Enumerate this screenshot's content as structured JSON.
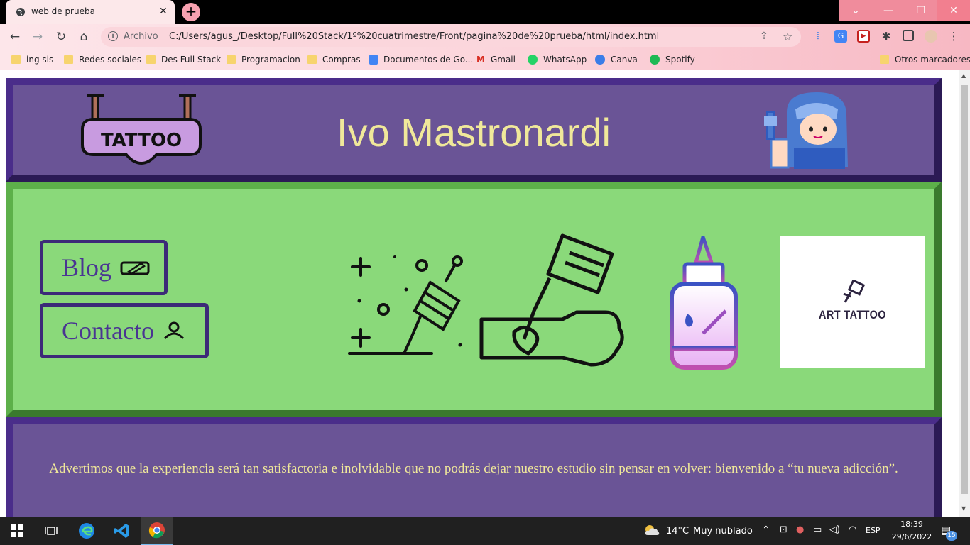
{
  "browser": {
    "tab_title": "web de prueba",
    "tab_close": "✕",
    "new_tab": "+",
    "window_controls": {
      "minimize": "—",
      "maximize": "❐",
      "close": "✕",
      "dropdown": "⌄"
    },
    "nav": {
      "back": "←",
      "forward": "→",
      "reload": "↻",
      "home": "⌂"
    },
    "address": {
      "scheme_label": "Archivo",
      "url": "C:/Users/agus_/Desktop/Full%20Stack/1º%20cuatrimestre/Front/pagina%20de%20prueba/html/index.html"
    },
    "bookmarks": [
      {
        "label": "ing sis",
        "icon": "folder-icon"
      },
      {
        "label": "Redes sociales",
        "icon": "folder-icon"
      },
      {
        "label": "Des Full Stack",
        "icon": "folder-icon"
      },
      {
        "label": "Programacion",
        "icon": "folder-icon"
      },
      {
        "label": "Compras",
        "icon": "folder-icon"
      },
      {
        "label": "Documentos de Go...",
        "icon": "google-docs-icon"
      },
      {
        "label": "Gmail",
        "icon": "gmail-icon"
      },
      {
        "label": "WhatsApp",
        "icon": "whatsapp-icon"
      },
      {
        "label": "Canva",
        "icon": "canva-icon"
      },
      {
        "label": "Spotify",
        "icon": "spotify-icon"
      }
    ],
    "other_bookmarks": "Otros marcadores"
  },
  "page": {
    "header": {
      "title": "Ivo Mastronardi",
      "logo_text": "TATTOO"
    },
    "nav": {
      "blog_label": "Blog",
      "contact_label": "Contacto"
    },
    "art_card_label": "ART TATTOO",
    "footer_text": "Advertimos que la experiencia será tan satisfactoria e inolvidable que no podrás dejar nuestro estudio sin pensar en volver: bienvenido a “tu nueva adicción”.",
    "colors": {
      "header_bg": "#6a5496",
      "main_bg": "#8ad97a",
      "title_color": "#f0e89a",
      "nav_text": "#4a3592"
    }
  },
  "taskbar": {
    "weather_temp": "14°C",
    "weather_desc": "Muy nublado",
    "language": "ESP",
    "time": "18:39",
    "date": "29/6/2022",
    "notification_count": "15"
  }
}
